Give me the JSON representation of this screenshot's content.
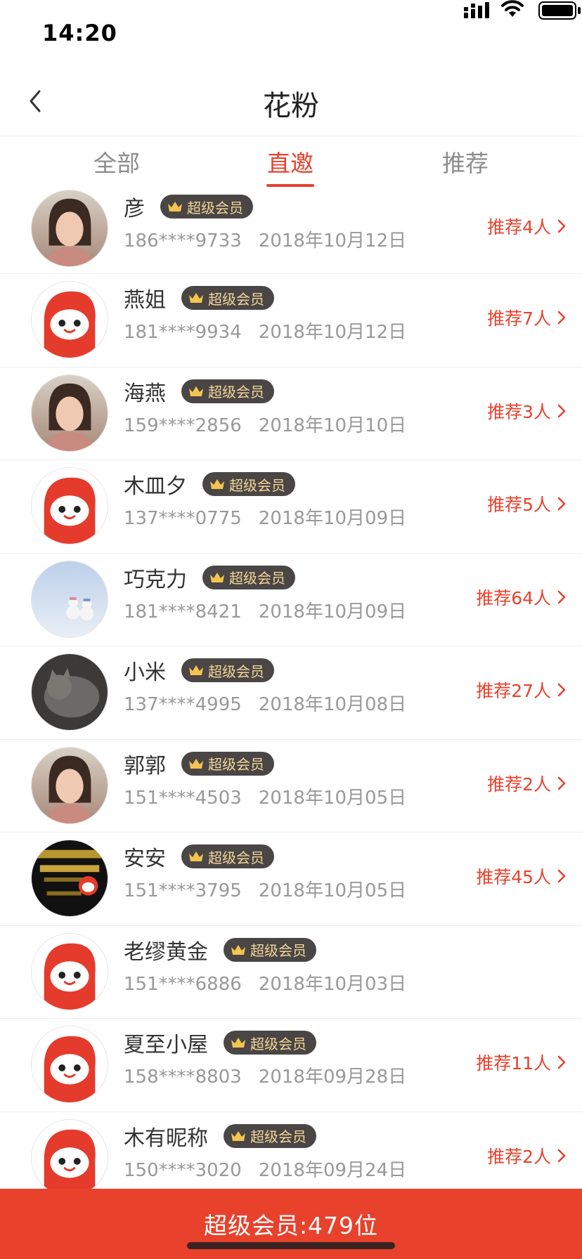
{
  "status_bar": {
    "time": "14:20"
  },
  "nav": {
    "title": "花粉"
  },
  "tabs": [
    {
      "label": "全部",
      "active": false
    },
    {
      "label": "直邀",
      "active": true
    },
    {
      "label": "推荐",
      "active": false
    }
  ],
  "badge_label": "超级会员",
  "users": [
    {
      "name": "彦",
      "phone": "186****9733",
      "date": "2018年10月12日",
      "recommend": "推荐4人",
      "avatar": "photo-woman-icon"
    },
    {
      "name": "燕姐",
      "phone": "181****9934",
      "date": "2018年10月12日",
      "recommend": "推荐7人",
      "avatar": "default-mascot-icon"
    },
    {
      "name": "海燕",
      "phone": "159****2856",
      "date": "2018年10月10日",
      "recommend": "推荐3人",
      "avatar": "photo-woman-icon"
    },
    {
      "name": "木皿夕",
      "phone": "137****0775",
      "date": "2018年10月09日",
      "recommend": "推荐5人",
      "avatar": "default-mascot-icon"
    },
    {
      "name": "巧克力",
      "phone": "181****8421",
      "date": "2018年10月09日",
      "recommend": "推荐64人",
      "avatar": "photo-snowmen-icon"
    },
    {
      "name": "小米",
      "phone": "137****4995",
      "date": "2018年10月08日",
      "recommend": "推荐27人",
      "avatar": "photo-cat-icon"
    },
    {
      "name": "郭郭",
      "phone": "151****4503",
      "date": "2018年10月05日",
      "recommend": "推荐2人",
      "avatar": "photo-woman-icon"
    },
    {
      "name": "安安",
      "phone": "151****3795",
      "date": "2018年10月05日",
      "recommend": "推荐45人",
      "avatar": "photo-poster-icon"
    },
    {
      "name": "老缪黄金",
      "phone": "151****6886",
      "date": "2018年10月03日",
      "recommend": "",
      "avatar": "default-mascot-icon"
    },
    {
      "name": "夏至小屋",
      "phone": "158****8803",
      "date": "2018年09月28日",
      "recommend": "推荐11人",
      "avatar": "default-mascot-icon"
    },
    {
      "name": "木有昵称",
      "phone": "150****3020",
      "date": "2018年09月24日",
      "recommend": "推荐2人",
      "avatar": "default-mascot-icon"
    }
  ],
  "footer": {
    "label": "超级会员:479位"
  },
  "colors": {
    "accent": "#e8412c",
    "badge_bg": "#4a4645",
    "badge_text": "#f3d699"
  }
}
